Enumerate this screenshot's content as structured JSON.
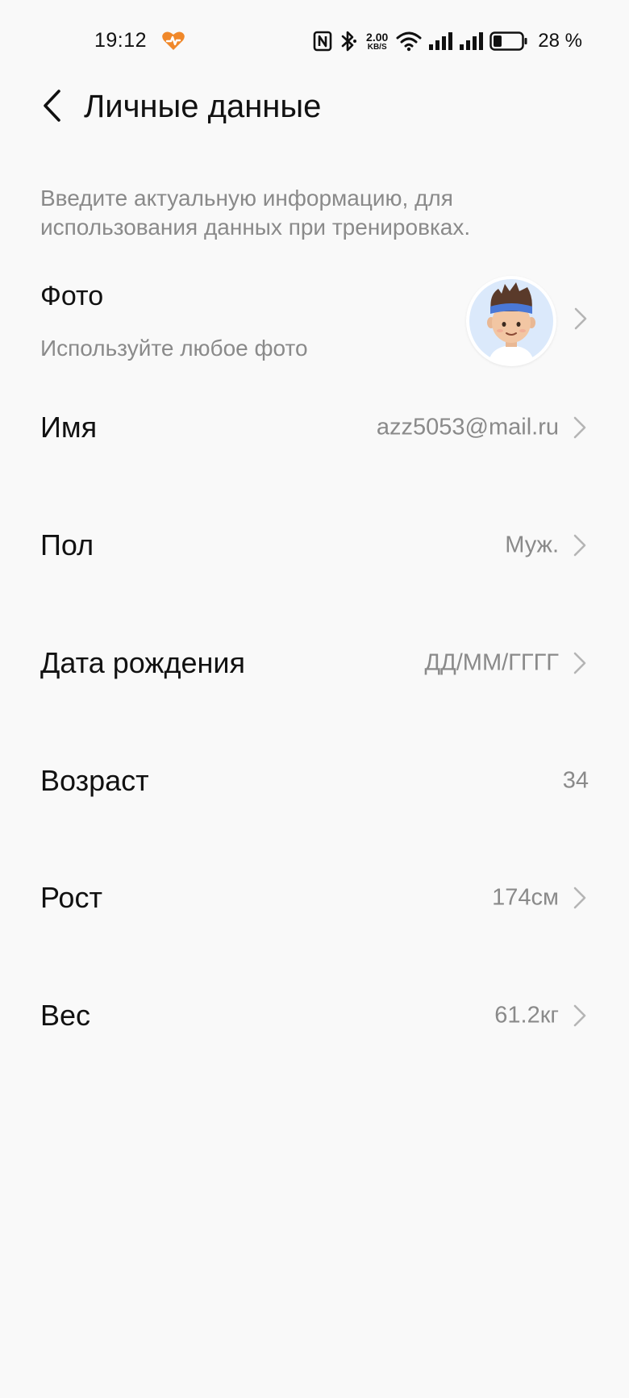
{
  "status_bar": {
    "time": "19:12",
    "net_speed_value": "2.00",
    "net_speed_unit": "KB/S",
    "battery_percent": "28 %",
    "app_icon_color": "#f0882a"
  },
  "header": {
    "title": "Личные данные"
  },
  "description": "Введите актуальную информацию, для использования данных при тренировках.",
  "photo": {
    "title": "Фото",
    "subtitle": "Используйте любое фото"
  },
  "fields": {
    "name": {
      "label": "Имя",
      "value": "azz5053@mail.ru"
    },
    "gender": {
      "label": "Пол",
      "value": "Муж."
    },
    "birthdate": {
      "label": "Дата рождения",
      "value": "ДД/ММ/ГГГГ"
    },
    "age": {
      "label": "Возраст",
      "value": "34"
    },
    "height": {
      "label": "Рост",
      "value": "174см"
    },
    "weight": {
      "label": "Вес",
      "value": "61.2кг"
    }
  },
  "colors": {
    "background": "#f9f9f9",
    "primary_text": "#111111",
    "secondary_text": "#8a8a8a",
    "chevron": "#b5b5b5",
    "avatar_bg": "#dbe9fb",
    "headband": "#4a78d6"
  }
}
